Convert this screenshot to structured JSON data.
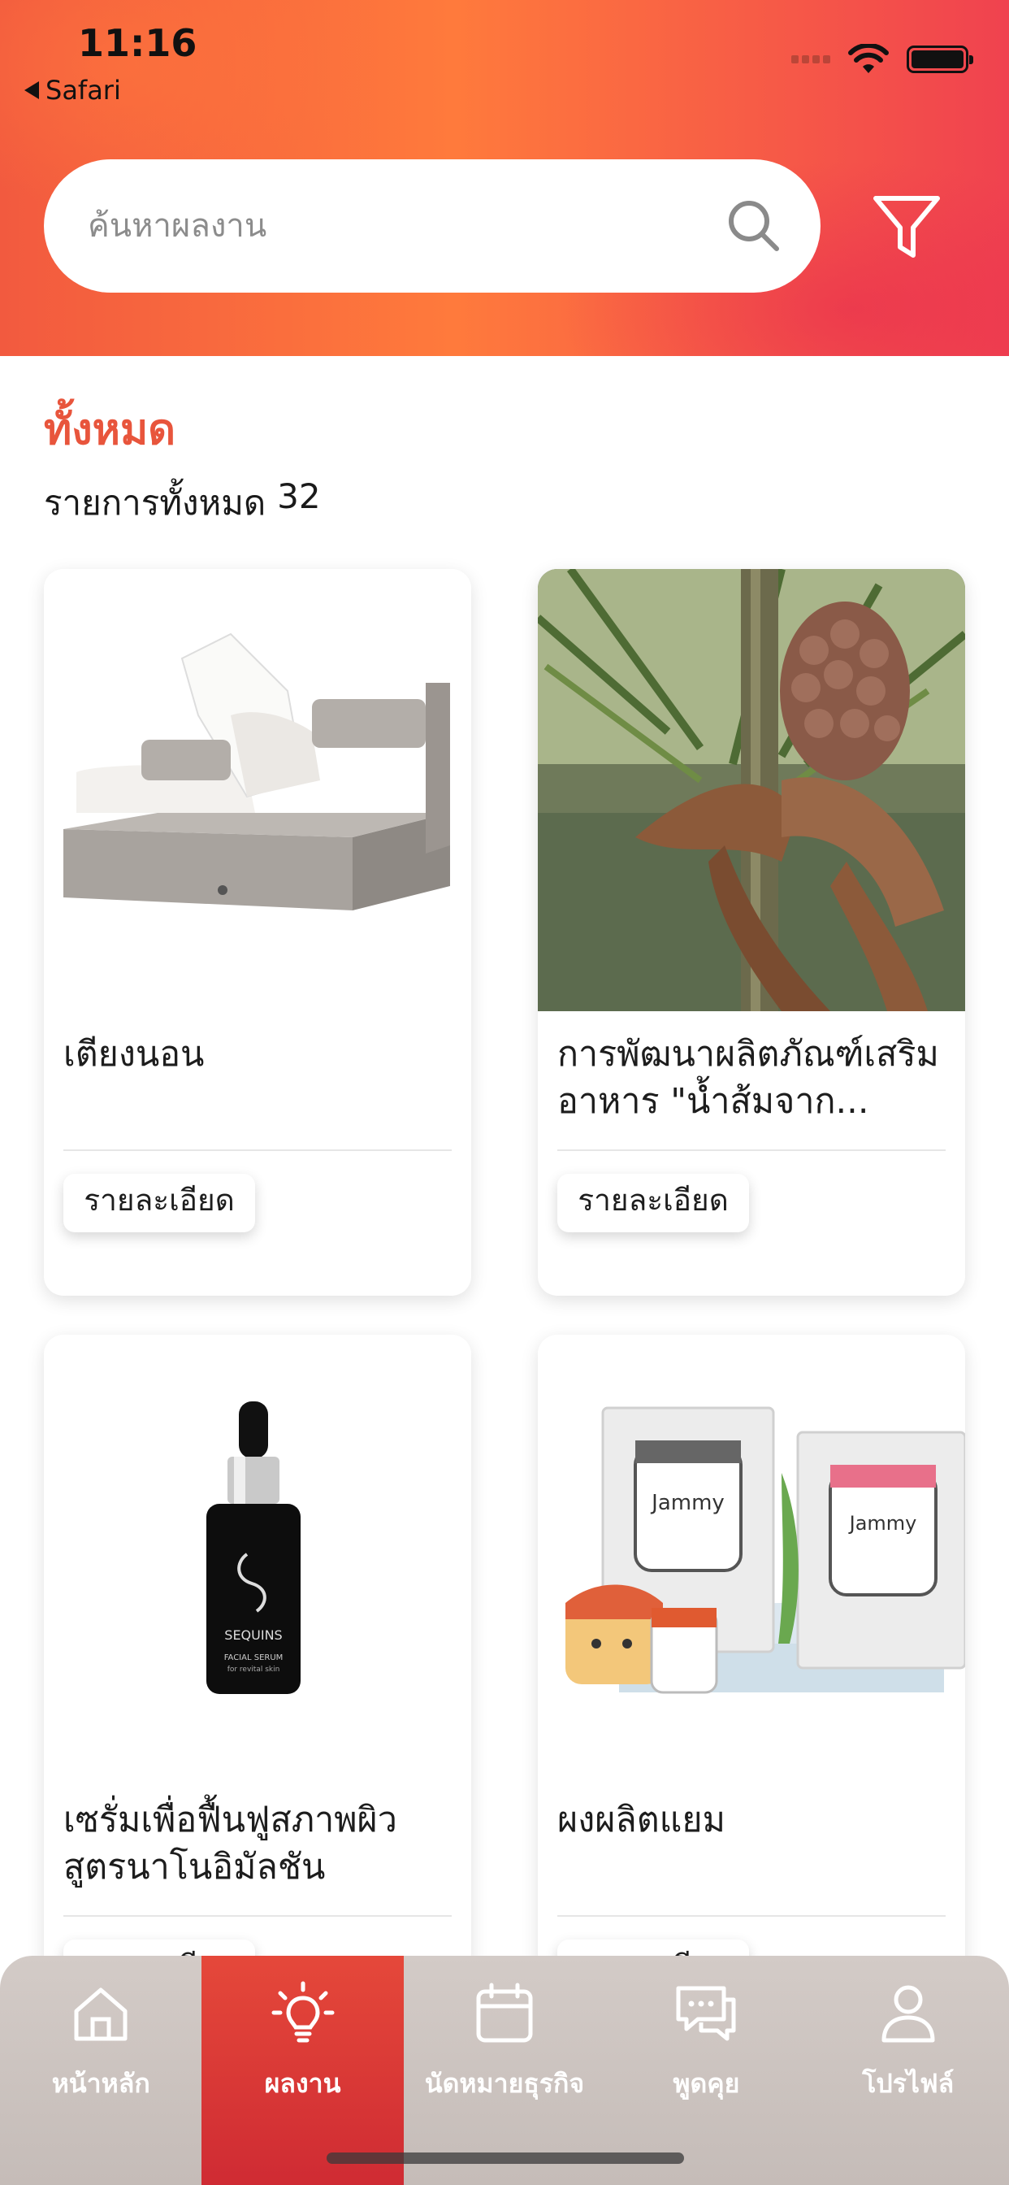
{
  "status_bar": {
    "time": "11:16",
    "back_label": "Safari"
  },
  "search": {
    "placeholder": "ค้นหาผลงาน",
    "value": ""
  },
  "section": {
    "title": "ทั้งหมด",
    "count_label": "รายการทั้งหมด",
    "count": "32"
  },
  "cards": [
    {
      "title": "เตียงนอน",
      "button_label": "รายละเอียด",
      "image": "adjustable-bed-image"
    },
    {
      "title": "การพัฒนาผลิตภัณฑ์เสริมอาหาร \"น้ำส้มจาก...",
      "button_label": "รายละเอียด",
      "image": "nipa-palm-fruit-image"
    },
    {
      "title": "เซรั่มเพื่อฟื้นฟูสภาพผิวสูตรนาโนอิมัลชัน",
      "button_label": "รายละเอียด",
      "image": "serum-bottle-image"
    },
    {
      "title": "ผงผลิตแยม",
      "button_label": "รายละเอียด",
      "image": "jam-powder-packets-image"
    }
  ],
  "product_text": {
    "serum_brand": "SEQUINS",
    "serum_line1": "FACIAL SERUM",
    "serum_line2": "for revital skin",
    "jam_brand": "Jammy"
  },
  "tabs": [
    {
      "label": "หน้าหลัก",
      "icon": "home-icon",
      "active": false
    },
    {
      "label": "ผลงาน",
      "icon": "lightbulb-icon",
      "active": true
    },
    {
      "label": "นัดหมายธุรกิจ",
      "icon": "calendar-icon",
      "active": false
    },
    {
      "label": "พูดคุย",
      "icon": "chat-icon",
      "active": false
    },
    {
      "label": "โปรไฟล์",
      "icon": "person-icon",
      "active": false
    }
  ],
  "colors": {
    "accent": "#e8553c",
    "active_tab": "#d9363a",
    "tab_bar": "#c9c0bc"
  }
}
